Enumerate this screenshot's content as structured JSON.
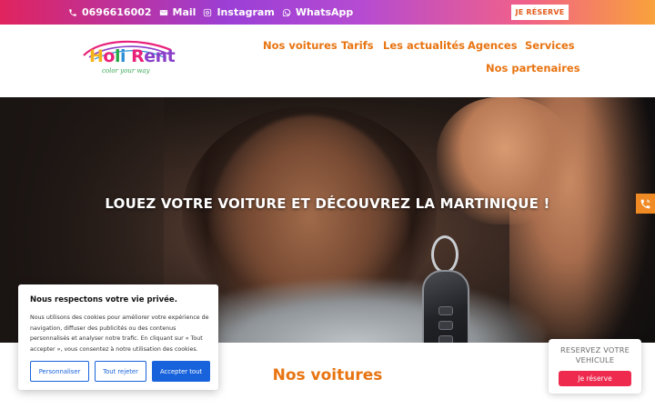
{
  "topbar": {
    "phone": "0696616002",
    "mail": "Mail",
    "instagram": "Instagram",
    "whatsapp": "WhatsApp",
    "reserve_label": "JE RÉSERVE",
    "colors": {
      "gradient_start": "#e0245e",
      "gradient_mid": "#9b3fd6",
      "gradient_end": "#f9a23b"
    }
  },
  "logo": {
    "name_part1": "H",
    "name_part2": "o",
    "name_part3": "l",
    "name_part4": "i",
    "name_part5": " R",
    "name_part6": "ent",
    "tagline": "color your way"
  },
  "nav": {
    "items": [
      "Nos voitures",
      "Tarifs",
      "Les actualités",
      "Agences",
      "Services",
      "Nos partenaires"
    ],
    "color": "#e87411"
  },
  "hero": {
    "headline": "LOUEZ VOTRE VOITURE ET DÉCOUVREZ LA MARTINIQUE !"
  },
  "side_contact": {
    "icon": "phone-icon",
    "color": "#f08a24"
  },
  "section": {
    "title": "Nos voitures"
  },
  "cookie_banner": {
    "title": "Nous respectons votre vie privée.",
    "body": "Nous utilisons des cookies pour améliorer votre expérience de navigation, diffuser des publicités ou des contenus personnalisés et analyser notre trafic. En cliquant sur « Tout accepter », vous consentez à notre utilisation des cookies.",
    "customize": "Personnaliser",
    "reject": "Tout rejeter",
    "accept": "Accepter tout",
    "accent": "#1863dc"
  },
  "reserve_widget": {
    "title_line1": "RESERVEZ VOTRE",
    "title_line2": "VEHICULE",
    "button": "Je réserve",
    "button_color": "#ee2a4e"
  }
}
